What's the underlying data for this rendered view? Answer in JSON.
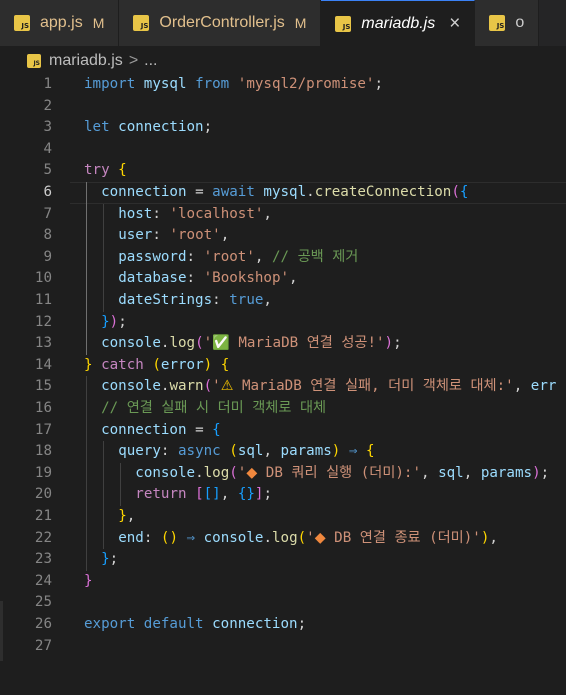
{
  "tabs": [
    {
      "label": "app.js",
      "status": "M",
      "active": false
    },
    {
      "label": "OrderController.js",
      "status": "M",
      "active": false
    },
    {
      "label": "mariadb.js",
      "status": "",
      "active": true
    },
    {
      "label": "o",
      "status": "",
      "active": false
    }
  ],
  "file_icon_text": "JS",
  "breadcrumb": {
    "file": "mariadb.js",
    "separator": ">",
    "ellipsis": "..."
  },
  "current_line": 6,
  "lines": [
    {
      "n": "1",
      "t": "import mysql from 'mysql2/promise';"
    },
    {
      "n": "2",
      "t": ""
    },
    {
      "n": "3",
      "t": "let connection;"
    },
    {
      "n": "4",
      "t": ""
    },
    {
      "n": "5",
      "t": "try {"
    },
    {
      "n": "6",
      "t": "  connection = await mysql.createConnection({"
    },
    {
      "n": "7",
      "t": "    host: 'localhost',"
    },
    {
      "n": "8",
      "t": "    user: 'root',"
    },
    {
      "n": "9",
      "t": "    password: 'root', // 공백 제거"
    },
    {
      "n": "10",
      "t": "    database: 'Bookshop',"
    },
    {
      "n": "11",
      "t": "    dateStrings: true,"
    },
    {
      "n": "12",
      "t": "  });"
    },
    {
      "n": "13",
      "t": "  console.log('✅ MariaDB 연결 성공!');"
    },
    {
      "n": "14",
      "t": "} catch (error) {"
    },
    {
      "n": "15",
      "t": "  console.warn('⚠️ MariaDB 연결 실패, 더미 객체로 대체:', err"
    },
    {
      "n": "16",
      "t": "  // 연결 실패 시 더미 객체로 대체"
    },
    {
      "n": "17",
      "t": "  connection = {"
    },
    {
      "n": "18",
      "t": "    query: async (sql, params) ⇒ {"
    },
    {
      "n": "19",
      "t": "      console.log('🔶 DB 쿼리 실행 (더미):', sql, params);"
    },
    {
      "n": "20",
      "t": "      return [[], {}];"
    },
    {
      "n": "21",
      "t": "    },"
    },
    {
      "n": "22",
      "t": "    end: () ⇒ console.log('🔶 DB 연결 종료 (더미)'),"
    },
    {
      "n": "23",
      "t": "  };"
    },
    {
      "n": "24",
      "t": "}"
    },
    {
      "n": "25",
      "t": ""
    },
    {
      "n": "26",
      "t": "export default connection;"
    },
    {
      "n": "27",
      "t": ""
    }
  ]
}
